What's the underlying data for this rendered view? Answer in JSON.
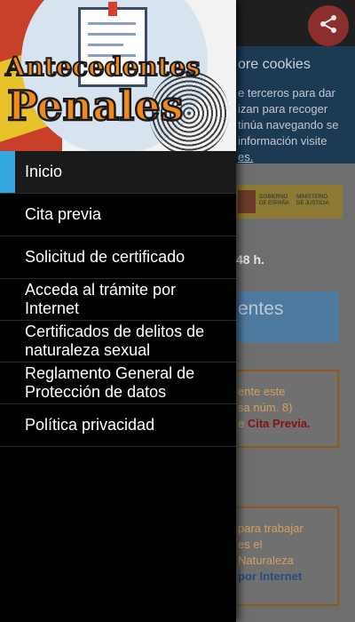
{
  "background": {
    "cookie_title": "ore cookies",
    "cookie_text_lines": [
      "e terceros para dar",
      "izan para recoger",
      "tinúa navegando se",
      "información visite",
      "es."
    ],
    "gov_logo_left": "GOBIERNO DE ESPAÑA",
    "gov_logo_right": "MINISTERIO DE JUSTICIA",
    "hours_text": "48 h.",
    "blue_box_text": "entes",
    "box1_lines": [
      "ente este",
      "sa núm. 8)"
    ],
    "box1_prefix": "e ",
    "box1_link": "Cita Previa.",
    "box2_lines": [
      "para trabajar",
      "es el",
      "Naturaleza"
    ],
    "box2_link": "por Internet"
  },
  "drawer": {
    "header_title_line1": "Antecedentes",
    "header_title_line2": "Penales",
    "menu_items": [
      {
        "label": "Inicio",
        "active": true
      },
      {
        "label": "Cita previa"
      },
      {
        "label": "Solicitud de certificado"
      },
      {
        "label": "Acceda al trámite por Internet"
      },
      {
        "label": "Certificados de delitos de naturaleza sexual"
      },
      {
        "label": "Reglamento General de Protección de datos"
      },
      {
        "label": "Política privacidad"
      }
    ]
  },
  "icons": {
    "share": "share-icon"
  },
  "colors": {
    "accent": "#35a7e0",
    "drawer_bg": "#000000",
    "title_orange": "#f08a1c"
  }
}
